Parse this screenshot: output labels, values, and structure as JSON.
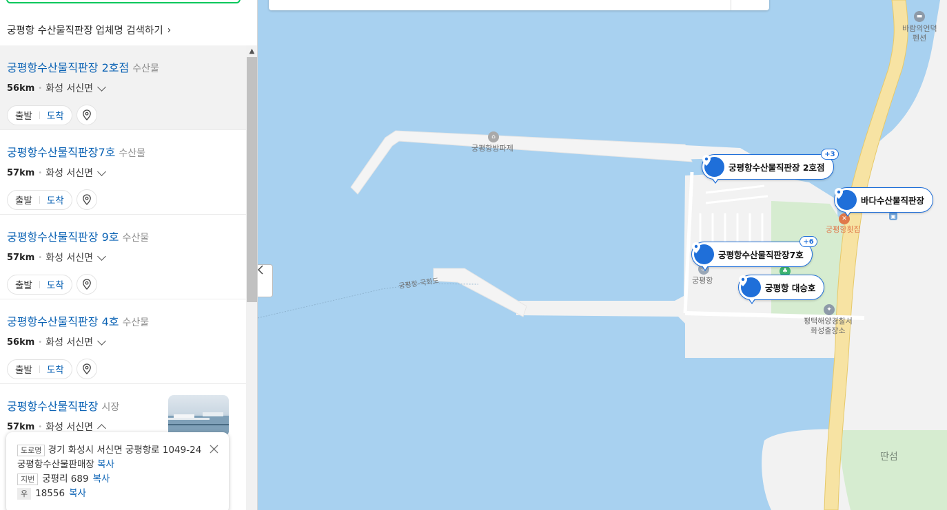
{
  "sidebar": {
    "search_link": {
      "keyword": "궁평항 수산물직판장",
      "rest": "업체명 검색하기",
      "chevron": "›"
    },
    "results": [
      {
        "name": "궁평항수산물직판장 2호점",
        "category": "수산물",
        "distance": "56km",
        "area": "화성 서신면",
        "depart": "출발",
        "arrive": "도착",
        "selected": true
      },
      {
        "name": "궁평항수산물직판장7호",
        "category": "수산물",
        "distance": "57km",
        "area": "화성 서신면",
        "depart": "출발",
        "arrive": "도착"
      },
      {
        "name": "궁평항수산물직판장 9호",
        "category": "수산물",
        "distance": "57km",
        "area": "화성 서신면",
        "depart": "출발",
        "arrive": "도착"
      },
      {
        "name": "궁평항수산물직판장 4호",
        "category": "수산물",
        "distance": "56km",
        "area": "화성 서신면",
        "depart": "출발",
        "arrive": "도착"
      },
      {
        "name": "궁평항수산물직판장",
        "category": "시장",
        "distance": "57km",
        "area": "화성 서신면"
      }
    ],
    "address_popup": {
      "road_tag": "도로명",
      "road_address": "경기 화성시 서신면 궁평항로 1049-24 궁평항수산물판매장",
      "road_copy": "복사",
      "lot_tag": "지번",
      "lot_address": "궁평리 689",
      "lot_copy": "복사",
      "zip_tag": "우",
      "zip": "18556",
      "zip_copy": "복사"
    }
  },
  "map": {
    "colors": {
      "water": "#a8d1f0",
      "land": "#f2f2f2",
      "park": "#d6ecd0",
      "road": "#f7e3a3",
      "marker": "#1f6fd9"
    },
    "markers": [
      {
        "label": "궁평항수산물직판장 2호점",
        "badge": "+3"
      },
      {
        "label": "바다수산물직판장",
        "badge": ""
      },
      {
        "label": "궁평항수산물직판장7호",
        "badge": "+6"
      },
      {
        "label": "궁평항 대승호",
        "badge": ""
      }
    ],
    "labels": {
      "breakwater": "궁평항방파제",
      "ferry_route": "궁평항-국화도",
      "port": "궁평항",
      "restaurant": "궁평항횟집",
      "police_line1": "평택해양경찰서",
      "police_line2": "화성출장소",
      "pension_line1": "바람의언덕",
      "pension_line2": "펜션",
      "island": "딴섬"
    }
  }
}
